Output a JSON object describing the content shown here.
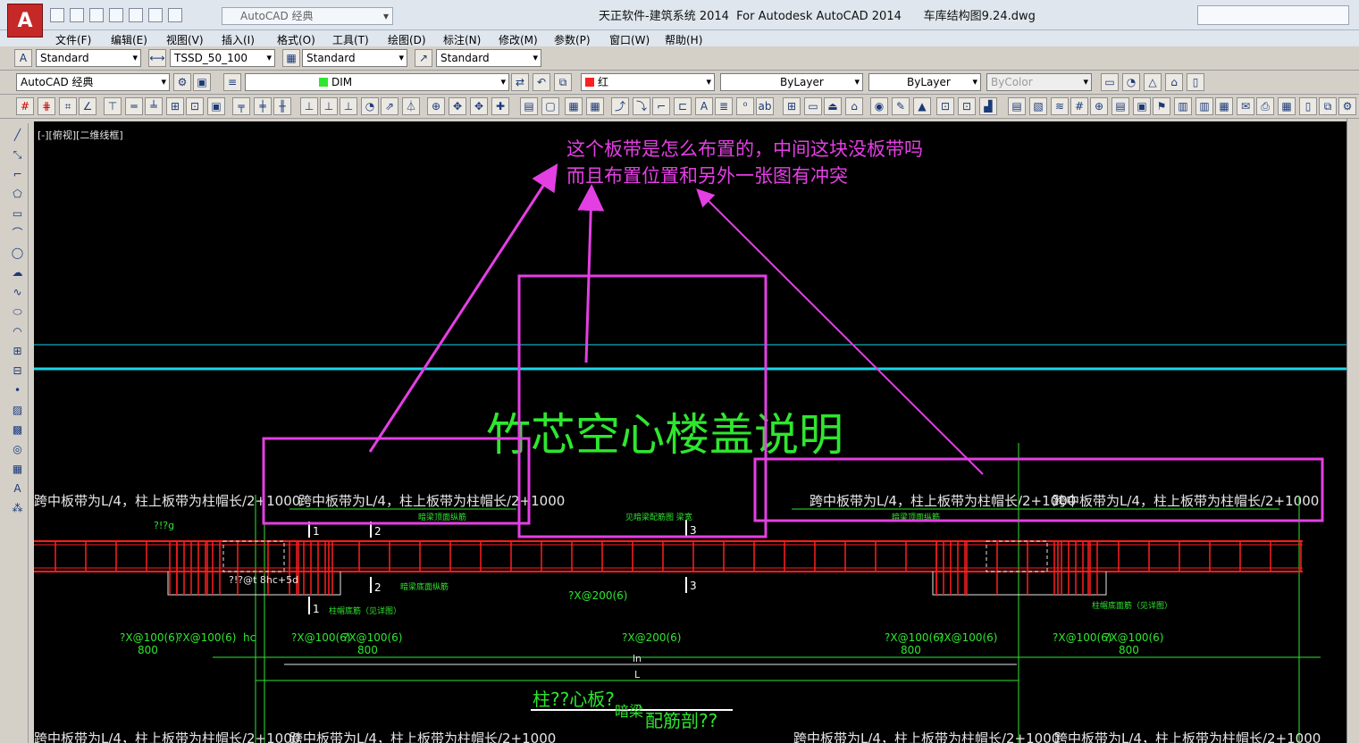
{
  "app": {
    "logo": "A",
    "workspace": "AutoCAD 经典",
    "window_title": "天正软件-建筑系统 2014  For Autodesk AutoCAD 2014      车库结构图9.24.dwg"
  },
  "menu": [
    "文件(F)",
    "编辑(E)",
    "视图(V)",
    "插入(I)",
    "格式(O)",
    "工具(T)",
    "绘图(D)",
    "标注(N)",
    "修改(M)",
    "参数(P)",
    "窗口(W)",
    "帮助(H)"
  ],
  "styles_toolbar": {
    "text_style": "Standard",
    "dim_style": "TSSD_50_100",
    "table_style": "Standard",
    "multileader_style": "Standard"
  },
  "layers_toolbar": {
    "workspace": "AutoCAD 经典",
    "layer": "DIM",
    "color": "红",
    "linetype": "ByLayer",
    "lineweight": "ByLayer",
    "plotstyle": "ByColor"
  },
  "colors": {
    "canvas": "#000000",
    "annotation": "#e43fe3",
    "drawing_green": "#2fe62f",
    "beam_red": "#ff1f1f",
    "guide_cyan": "#19d6e6"
  },
  "viewport_label": "[-][俯视][二维线框]",
  "annotation": {
    "line1": "这个板带是怎么布置的，中间这块没板带吗",
    "line2": "而且布置位置和另外一张图有冲突"
  },
  "drawing": {
    "heading": "竹芯空心楼盖说明",
    "band_label": "跨中板带为L/4，柱上板带为柱帽长/2+1000",
    "marker_1": "1",
    "marker_2": "2",
    "marker_3": "3",
    "top_note_left": "?!?g",
    "side_note": "?!?@t 8hc+5d",
    "note_top_rebar": "暗梁顶面纵筋",
    "note_bottom_rebar": "暗梁底面纵筋",
    "note_stirrup": "见暗梁配筋图 梁宽",
    "note_column_bottom": "柱帽底筋（见详图）",
    "note_right_top": "暗梁顶面纵筋",
    "note_right_bottom": "柱帽底面筋（见详图）",
    "stirrup_mid": "?X@200(6)",
    "dim_left_a": "?X@100(6)",
    "dim_left_b": "?X@100(6)",
    "dim_hc": "hc",
    "dim_mid_a": "?X@100(6)",
    "dim_mid_b": "?X@100(6)",
    "dim_center": "?X@200(6)",
    "dim_right_a": "?X@100(6)",
    "dim_right_b": "?X@100(6)",
    "dim_far_a": "?X@100(6)",
    "dim_far_b": "?X@100(6)",
    "dim_800_1": "800",
    "dim_800_2": "800",
    "dim_800_3": "800",
    "dim_800_4": "800",
    "dim_ln": "ln",
    "dim_L": "L",
    "caption_a": "柱??心板?",
    "caption_b": "暗梁",
    "caption_c": "配筋剖??"
  }
}
